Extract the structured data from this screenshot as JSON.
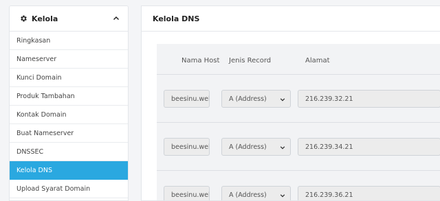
{
  "sidebar": {
    "title": "Kelola",
    "items": [
      {
        "label": "Ringkasan"
      },
      {
        "label": "Nameserver"
      },
      {
        "label": "Kunci Domain"
      },
      {
        "label": "Produk Tambahan"
      },
      {
        "label": "Kontak Domain"
      },
      {
        "label": "Buat Nameserver"
      },
      {
        "label": "DNSSEC"
      },
      {
        "label": "Kelola DNS",
        "active": true
      },
      {
        "label": "Upload Syarat Domain"
      }
    ]
  },
  "main": {
    "title": "Kelola DNS",
    "columns": {
      "host": "Nama Host",
      "type": "Jenis Record",
      "address": "Alamat"
    },
    "records": [
      {
        "host": "beesinu.web",
        "type": "A (Address)",
        "address": "216.239.32.21"
      },
      {
        "host": "beesinu.web",
        "type": "A (Address)",
        "address": "216.239.34.21"
      },
      {
        "host": "beesinu.web",
        "type": "A (Address)",
        "address": "216.239.36.21"
      }
    ]
  },
  "colors": {
    "accent": "#2aa8e0"
  },
  "icons": {
    "header": "gear-icon",
    "collapse": "chevron-up-icon",
    "select": "chevron-down-icon"
  }
}
